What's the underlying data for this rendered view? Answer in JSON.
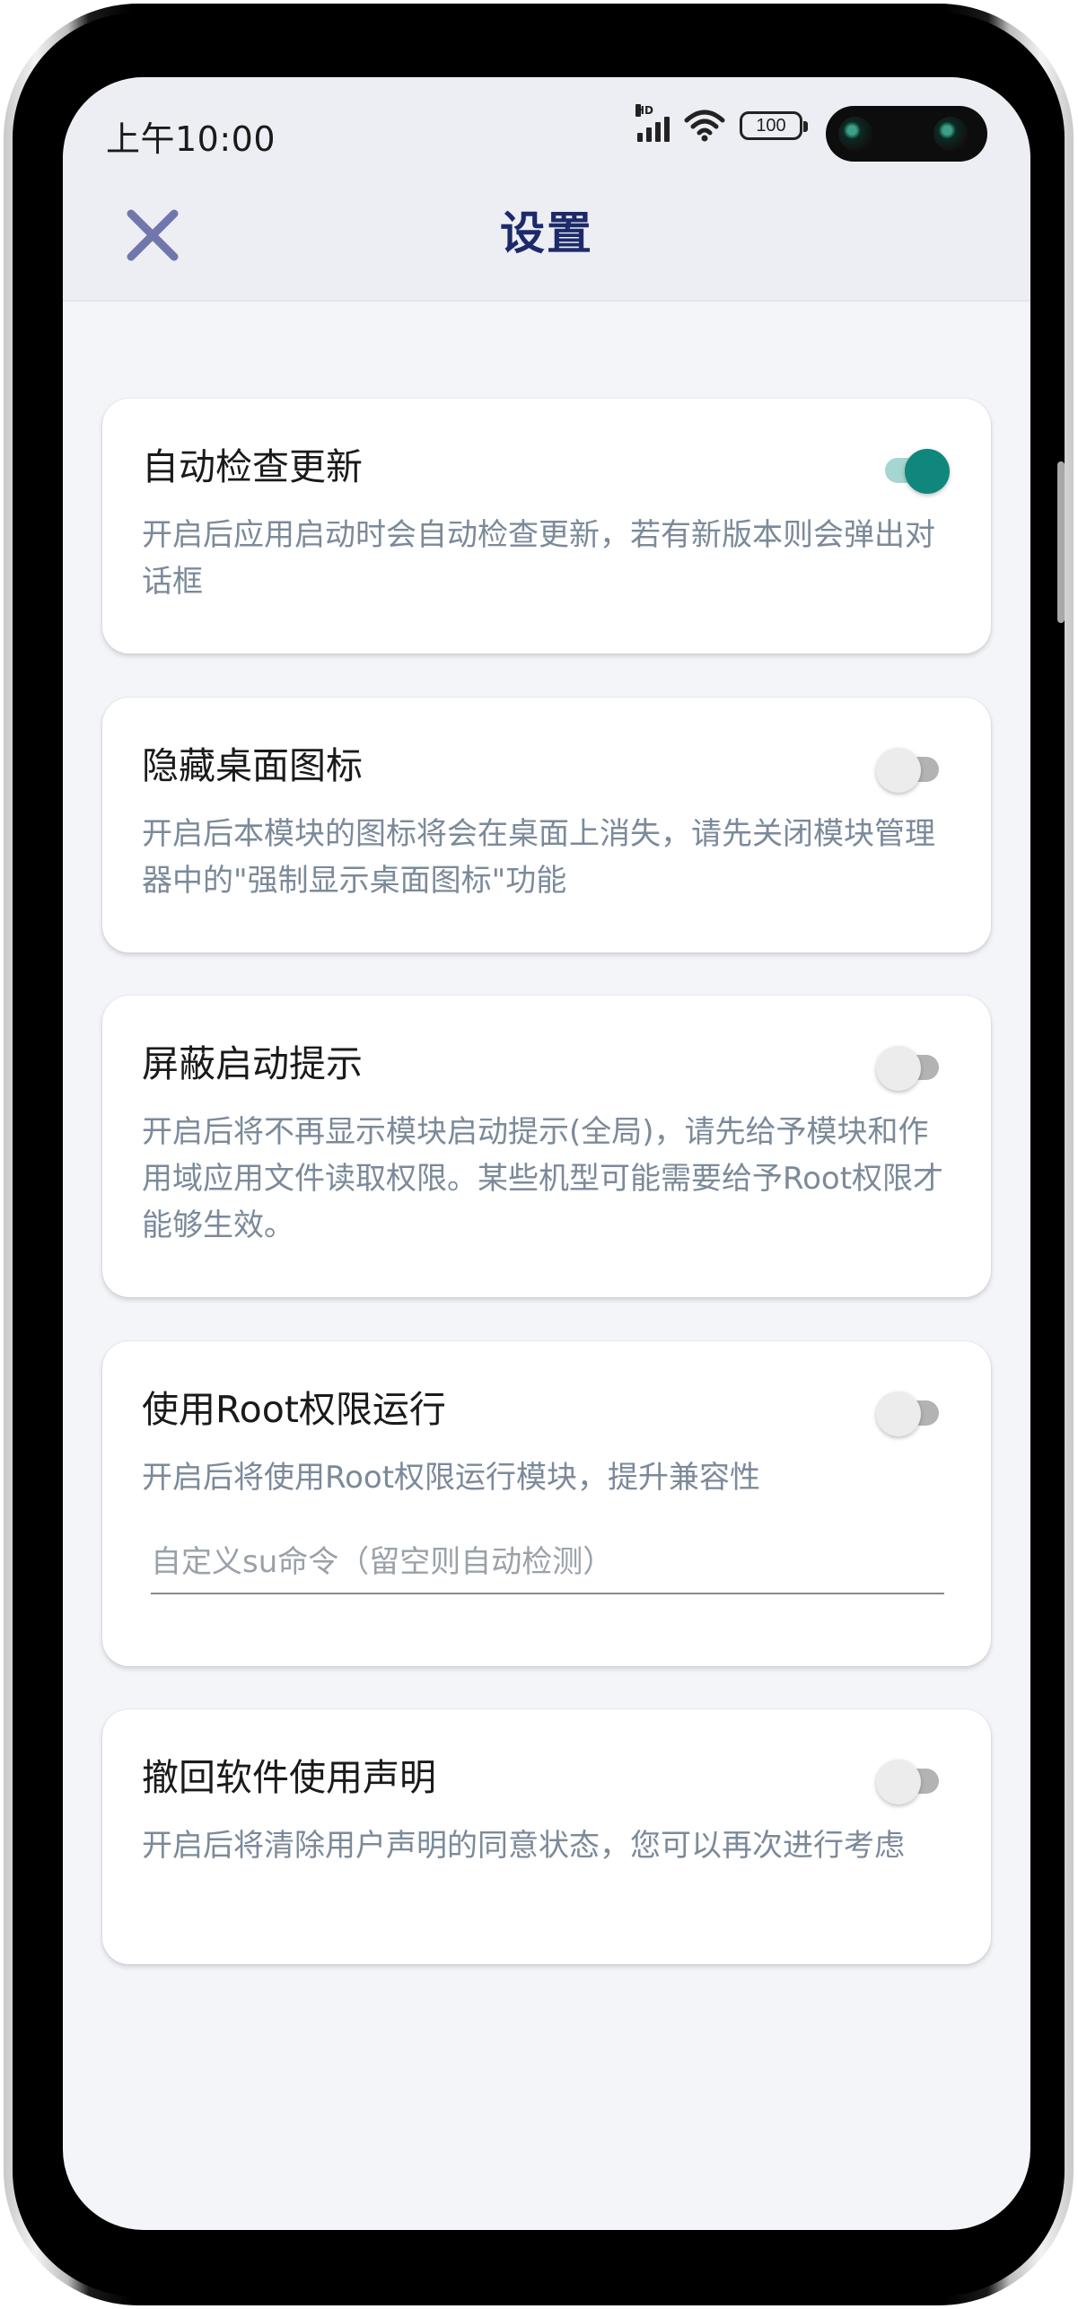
{
  "status_bar": {
    "time": "上午10:00",
    "network_badge": "HD",
    "battery": "100",
    "icons": [
      "signal-icon",
      "wifi-icon",
      "battery-icon"
    ]
  },
  "header": {
    "title": "设置",
    "close_icon": "close-icon"
  },
  "colors": {
    "accent": "#0f877d",
    "accent_track": "#a5d6cf",
    "title_color": "#1d2a6a",
    "close_icon": "#7177ad",
    "desc_text": "#7b8a9a"
  },
  "settings": [
    {
      "title": "自动检查更新",
      "description": "开启后应用启动时会自动检查更新，若有新版本则会弹出对话框",
      "enabled": true
    },
    {
      "title": "隐藏桌面图标",
      "description": "开启后本模块的图标将会在桌面上消失，请先关闭模块管理器中的\"强制显示桌面图标\"功能",
      "enabled": false
    },
    {
      "title": "屏蔽启动提示",
      "description": "开启后将不再显示模块启动提示(全局)，请先给予模块和作用域应用文件读取权限。某些机型可能需要给予Root权限才能够生效。",
      "enabled": false
    },
    {
      "title": "使用Root权限运行",
      "description": "开启后将使用Root权限运行模块，提升兼容性",
      "enabled": false,
      "input_value": "",
      "input_placeholder": "自定义su命令（留空则自动检测）"
    },
    {
      "title": "撤回软件使用声明",
      "description": "开启后将清除用户声明的同意状态，您可以再次进行考虑",
      "enabled": false
    }
  ]
}
